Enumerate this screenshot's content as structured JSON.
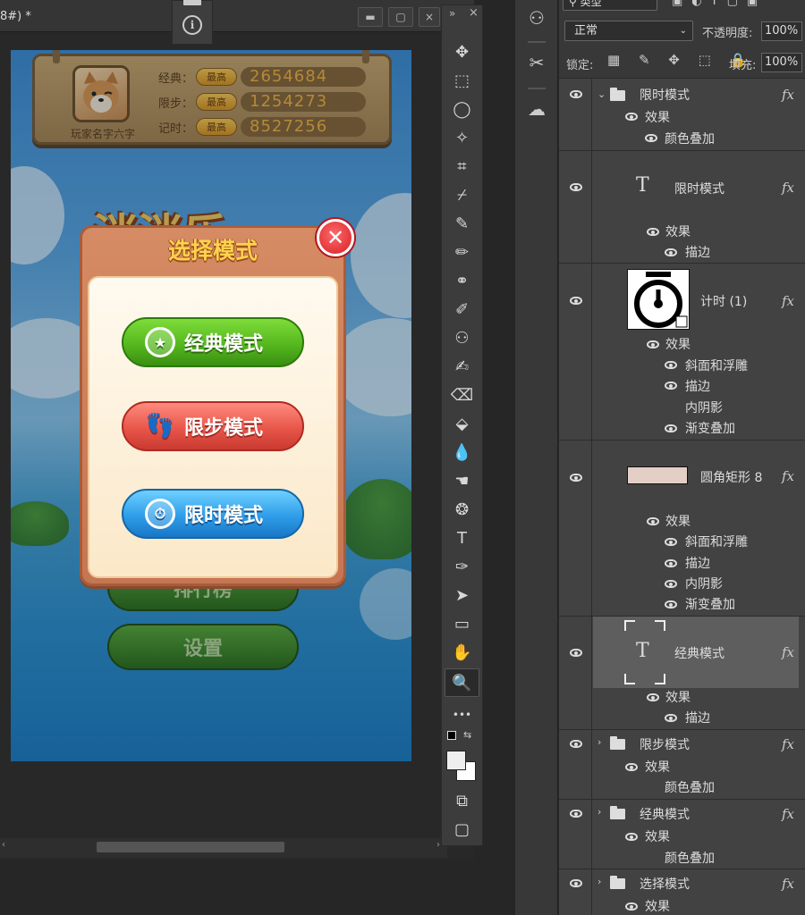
{
  "document": {
    "title": "8#) *",
    "info_glyph": "i",
    "win_min": "▬",
    "win_max": "▢",
    "win_close": "×"
  },
  "game": {
    "player_name": "玩家名字六字",
    "scores": [
      {
        "label": "经典：",
        "badge": "最高",
        "value": "2654684"
      },
      {
        "label": "限步：",
        "badge": "最高",
        "value": "1254273"
      },
      {
        "label": "记时：",
        "badge": "最高",
        "value": "8527256"
      }
    ],
    "title_art": "消消乐",
    "bg_buttons": [
      "排行榜",
      "设置"
    ],
    "modal": {
      "title": "选择模式",
      "close_glyph": "✕",
      "modes": [
        {
          "label": "经典模式",
          "icon": "star-icon",
          "glyph": "★"
        },
        {
          "label": "限步模式",
          "icon": "footprint-icon",
          "glyph": "👣"
        },
        {
          "label": "限时模式",
          "icon": "stopwatch-icon",
          "glyph": "⏱"
        }
      ]
    }
  },
  "toolbar": {
    "collapse": "»",
    "close": "×",
    "tools": [
      "✥",
      "⬚",
      "◯",
      "✧",
      "⌗",
      "⌿",
      "✎",
      "✏",
      "⚭",
      "✐",
      "⚇",
      "✍",
      "⌫",
      "⬙",
      "💧",
      "☚",
      "❂",
      "T",
      "✑",
      "➤",
      "▭",
      "✋",
      "🔍",
      "•••",
      "⧉",
      "▢"
    ]
  },
  "layers_panel": {
    "kind_label": "类型",
    "blend_mode": "正常",
    "opacity_label": "不透明度:",
    "opacity_value": "100%",
    "lock_label": "锁定:",
    "lock_icons": "▦ ✎ ✥ ⬚ 🔒",
    "fill_label": "填充:",
    "fill_value": "100%",
    "fx": "fx",
    "rows": {
      "g1_name": "限时模式",
      "g1_effect": "效果",
      "g1_e1": "颜色叠加",
      "t1_name": "限时模式",
      "t1_effect": "效果",
      "t1_e1": "描边",
      "s1_name": "计时 (1)",
      "s1_effect": "效果",
      "s1_e1": "斜面和浮雕",
      "s1_e2": "描边",
      "s1_e3": "内阴影",
      "s1_e4": "渐变叠加",
      "r1_name": "圆角矩形 8",
      "r1_effect": "效果",
      "r1_e1": "斜面和浮雕",
      "r1_e2": "描边",
      "r1_e3": "内阴影",
      "r1_e4": "渐变叠加",
      "t2_name": "经典模式",
      "t2_effect": "效果",
      "t2_e1": "描边",
      "g2_name": "限步模式",
      "g2_effect": "效果",
      "g2_e1": "颜色叠加",
      "g3_name": "经典模式",
      "g3_effect": "效果",
      "g3_e1": "颜色叠加",
      "g4_name": "选择模式",
      "g4_effect": "效果"
    }
  }
}
